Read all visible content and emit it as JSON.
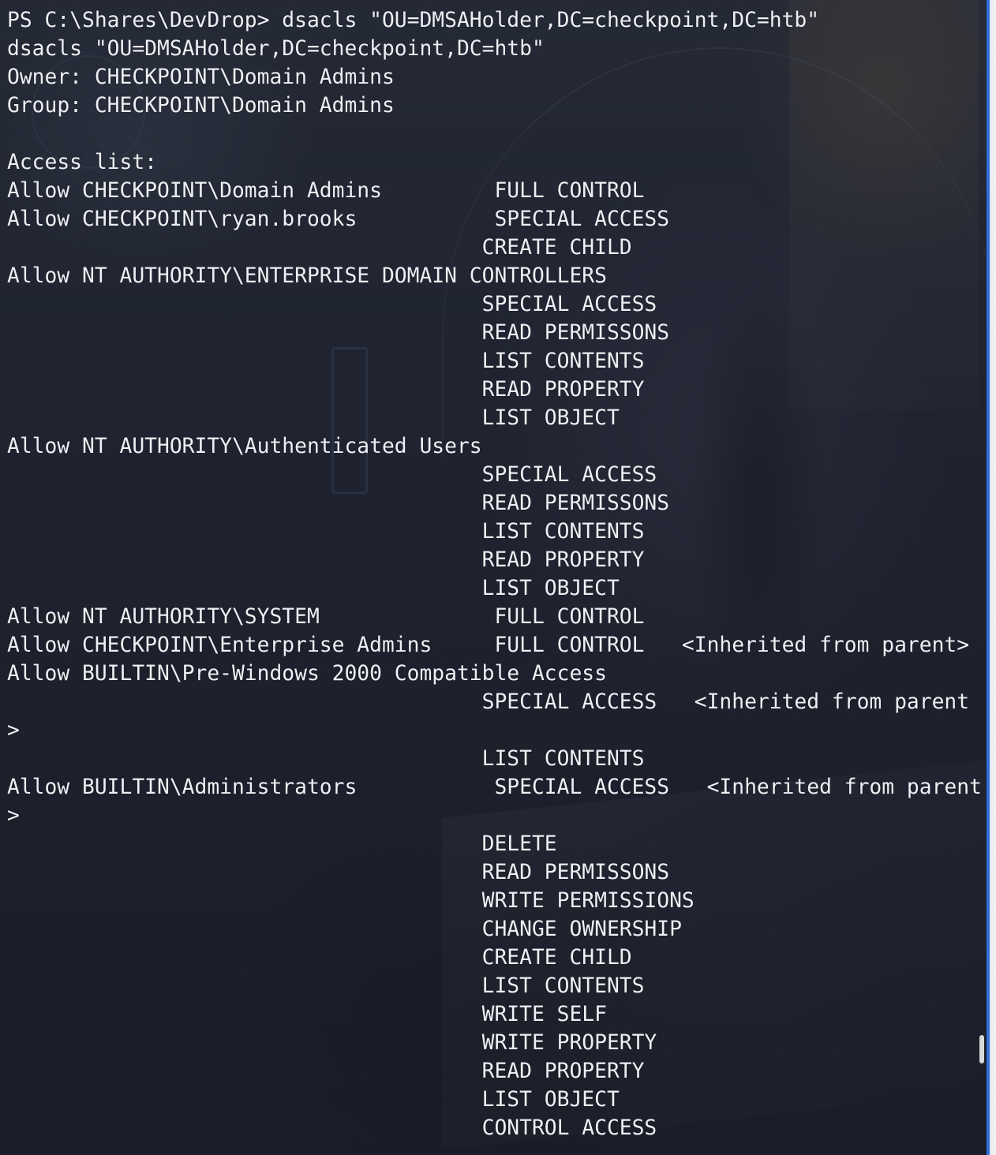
{
  "terminal": {
    "lines": [
      "PS C:\\Shares\\DevDrop> dsacls \"OU=DMSAHolder,DC=checkpoint,DC=htb\"",
      "dsacls \"OU=DMSAHolder,DC=checkpoint,DC=htb\"",
      "Owner: CHECKPOINT\\Domain Admins",
      "Group: CHECKPOINT\\Domain Admins",
      "",
      "Access list:",
      "Allow CHECKPOINT\\Domain Admins         FULL CONTROL",
      "Allow CHECKPOINT\\ryan.brooks           SPECIAL ACCESS",
      "                                      CREATE CHILD",
      "Allow NT AUTHORITY\\ENTERPRISE DOMAIN CONTROLLERS",
      "                                      SPECIAL ACCESS",
      "                                      READ PERMISSONS",
      "                                      LIST CONTENTS",
      "                                      READ PROPERTY",
      "                                      LIST OBJECT",
      "Allow NT AUTHORITY\\Authenticated Users",
      "                                      SPECIAL ACCESS",
      "                                      READ PERMISSONS",
      "                                      LIST CONTENTS",
      "                                      READ PROPERTY",
      "                                      LIST OBJECT",
      "Allow NT AUTHORITY\\SYSTEM              FULL CONTROL",
      "Allow CHECKPOINT\\Enterprise Admins     FULL CONTROL   <Inherited from parent>",
      "Allow BUILTIN\\Pre-Windows 2000 Compatible Access",
      "                                      SPECIAL ACCESS   <Inherited from parent",
      ">",
      "                                      LIST CONTENTS",
      "Allow BUILTIN\\Administrators           SPECIAL ACCESS   <Inherited from parent",
      ">",
      "                                      DELETE",
      "                                      READ PERMISSONS",
      "                                      WRITE PERMISSIONS",
      "                                      CHANGE OWNERSHIP",
      "                                      CREATE CHILD",
      "                                      LIST CONTENTS",
      "                                      WRITE SELF",
      "                                      WRITE PROPERTY",
      "                                      READ PROPERTY",
      "                                      LIST OBJECT",
      "                                      CONTROL ACCESS"
    ]
  },
  "colors": {
    "text": "#eef0f4",
    "terminal_bg": "#181c26",
    "accent_edge": "#2f6fe0",
    "scroll_thumb": "#d8d8d8"
  }
}
